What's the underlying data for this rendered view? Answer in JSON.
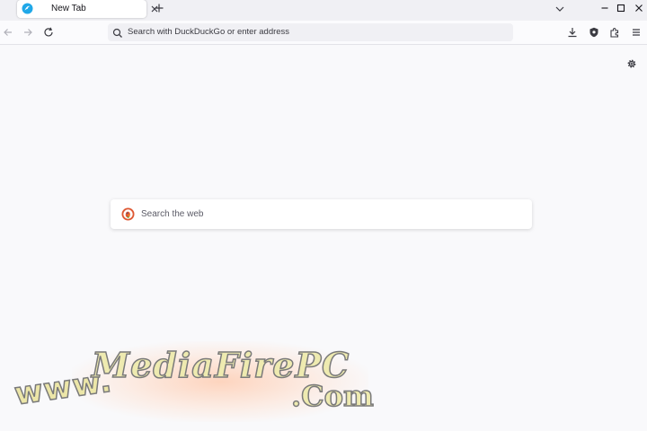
{
  "tab": {
    "title": "New Tab"
  },
  "urlbar": {
    "placeholder": "Search with DuckDuckGo or enter address"
  },
  "search": {
    "placeholder": "Search the web"
  },
  "watermark": {
    "prefix": "www.",
    "brand": "MediaFirePC",
    "suffix": ".Com"
  },
  "colors": {
    "accent": "#0060df",
    "duckduckgo": "#de5833",
    "background": "#f9f9fb"
  },
  "icons": [
    "firefox-icon",
    "close-icon",
    "plus-icon",
    "chevron-down-icon",
    "minimize-icon",
    "maximize-icon",
    "back-icon",
    "forward-icon",
    "reload-icon",
    "search-icon",
    "download-icon",
    "shield-icon",
    "extensions-icon",
    "menu-icon",
    "gear-icon",
    "duckduckgo-icon"
  ]
}
